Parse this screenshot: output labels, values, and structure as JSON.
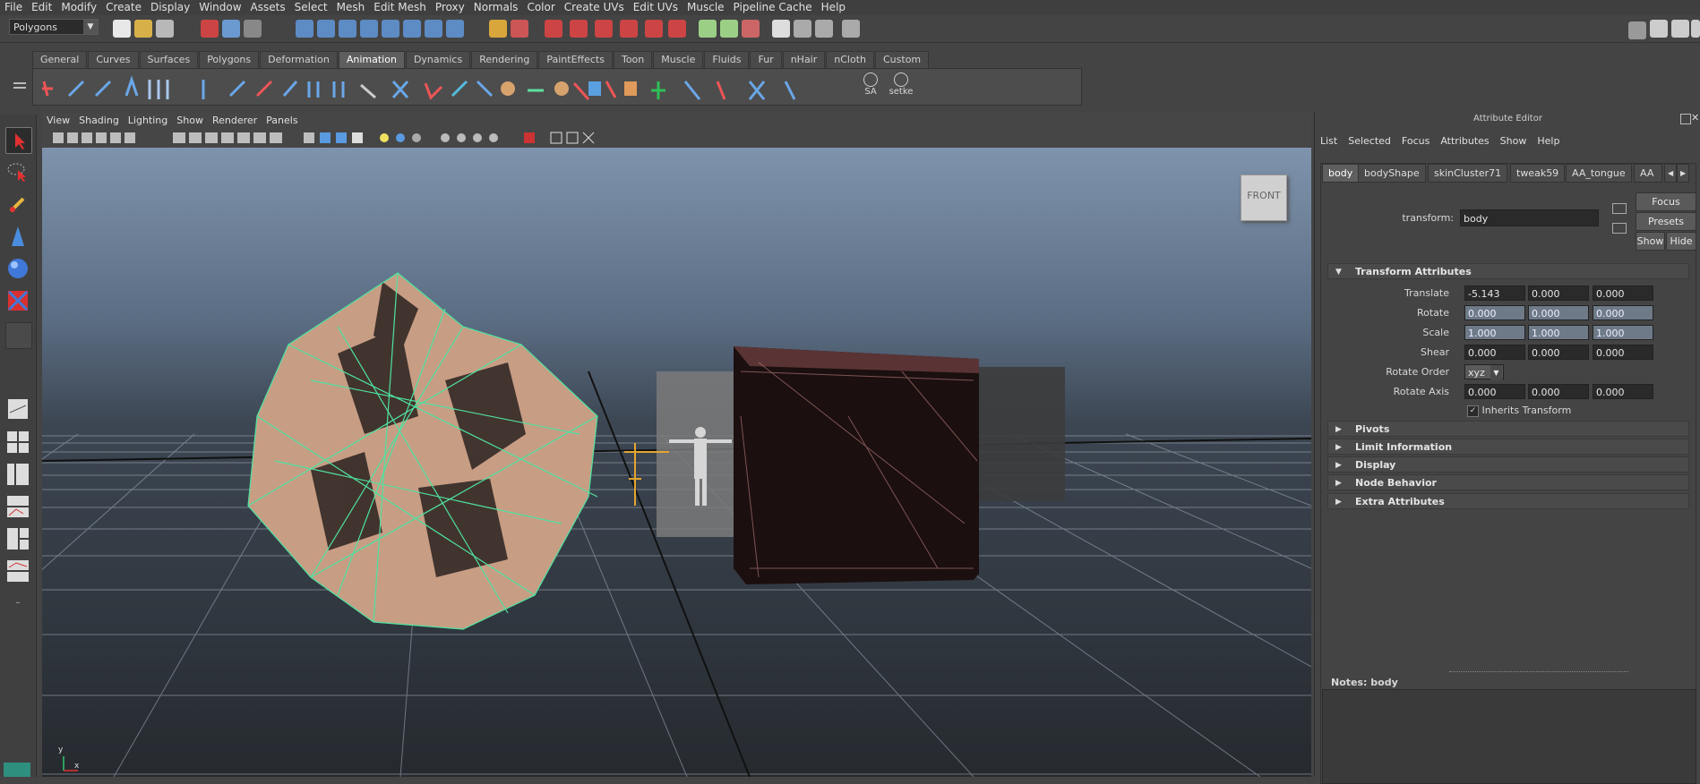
{
  "menubar": [
    "File",
    "Edit",
    "Modify",
    "Create",
    "Display",
    "Window",
    "Assets",
    "Select",
    "Mesh",
    "Edit Mesh",
    "Proxy",
    "Normals",
    "Color",
    "Create UVs",
    "Edit UVs",
    "Muscle",
    "Pipeline Cache",
    "Help"
  ],
  "status": {
    "mode_select": "Polygons"
  },
  "shelf_tabs": [
    "General",
    "Curves",
    "Surfaces",
    "Polygons",
    "Deformation",
    "Animation",
    "Dynamics",
    "Rendering",
    "PaintEffects",
    "Toon",
    "Muscle",
    "Fluids",
    "Fur",
    "nHair",
    "nCloth",
    "Custom"
  ],
  "shelf_active": "Animation",
  "shelf_labels": {
    "sa": "SA",
    "setke": "setke"
  },
  "viewport": {
    "menu": [
      "View",
      "Shading",
      "Lighting",
      "Show",
      "Renderer",
      "Panels"
    ],
    "view_cube_label": "FRONT",
    "axis_x": "x",
    "axis_y": "y"
  },
  "attribute_editor": {
    "title": "Attribute Editor",
    "menu": [
      "List",
      "Selected",
      "Focus",
      "Attributes",
      "Show",
      "Help"
    ],
    "tabs": [
      "body",
      "bodyShape",
      "skinCluster71",
      "tweak59",
      "AA_tongue",
      "AA"
    ],
    "active_tab": "body",
    "transform_label": "transform:",
    "transform_value": "body",
    "buttons": {
      "focus": "Focus",
      "presets": "Presets",
      "show": "Show",
      "hide": "Hide"
    },
    "transform_section": "Transform Attributes",
    "rows": {
      "translate": {
        "label": "Translate",
        "values": [
          "-5.143",
          "0.000",
          "0.000"
        ]
      },
      "rotate": {
        "label": "Rotate",
        "values": [
          "0.000",
          "0.000",
          "0.000"
        ]
      },
      "scale": {
        "label": "Scale",
        "values": [
          "1.000",
          "1.000",
          "1.000"
        ]
      },
      "shear": {
        "label": "Shear",
        "values": [
          "0.000",
          "0.000",
          "0.000"
        ]
      },
      "rotate_order": {
        "label": "Rotate Order",
        "value": "xyz"
      },
      "rotate_axis": {
        "label": "Rotate Axis",
        "values": [
          "0.000",
          "0.000",
          "0.000"
        ]
      }
    },
    "inherits_transform": "Inherits Transform",
    "collapsed_sections": [
      "Pivots",
      "Limit Information",
      "Display",
      "Node Behavior",
      "Extra Attributes"
    ],
    "notes_label": "Notes:  body"
  },
  "colors": {
    "selection_wire": "#4ee3a0",
    "ui_bg": "#444444",
    "field_bg": "#2a2a2a",
    "field_blue": "#6e7a88"
  }
}
